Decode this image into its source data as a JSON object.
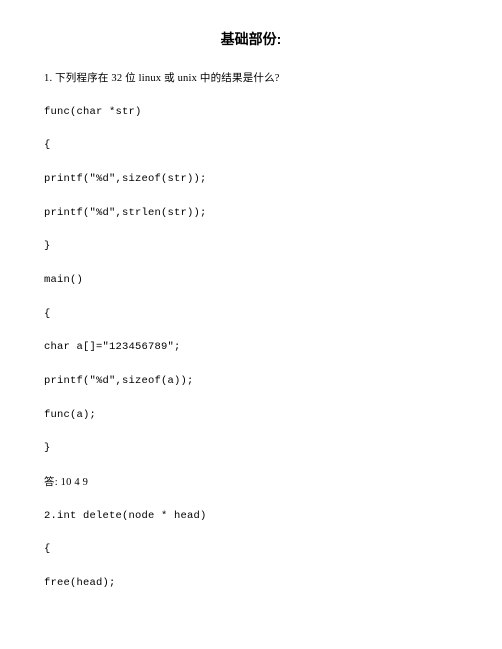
{
  "title": "基础部份:",
  "lines": [
    "1. 下列程序在 32 位 linux 或 unix 中的结果是什么?",
    "func(char *str)",
    "{",
    "printf(\"%d\",sizeof(str));",
    "printf(\"%d\",strlen(str));",
    "}",
    "main()",
    "{",
    "char a[]=\"123456789\";",
    "printf(\"%d\",sizeof(a));",
    "func(a);",
    "}",
    "答: 10 4 9",
    "2.int delete(node * head)",
    "{",
    "free(head);"
  ]
}
